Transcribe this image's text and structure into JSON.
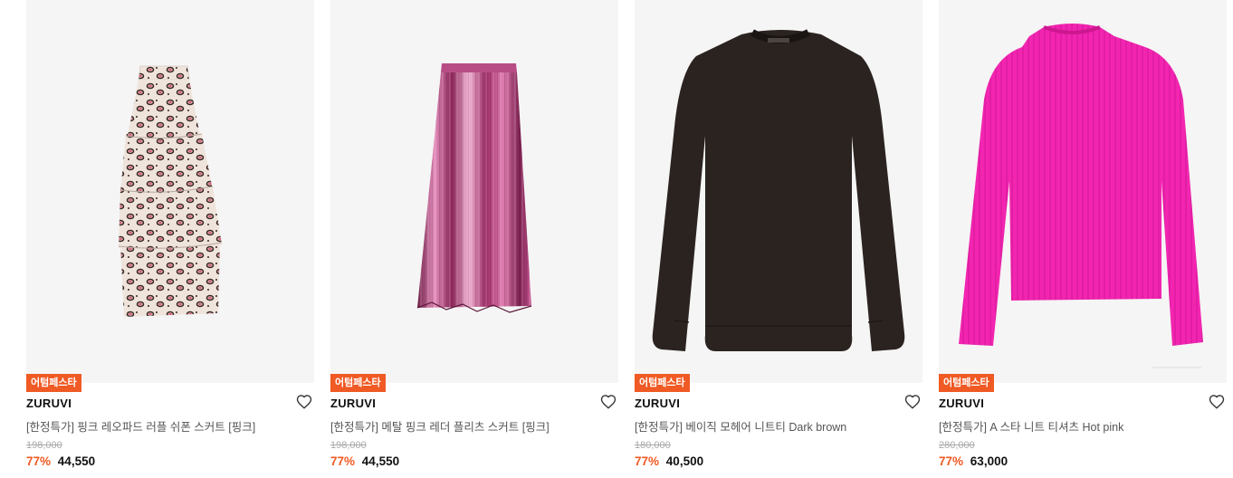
{
  "products": [
    {
      "badge": "어텀페스타",
      "brand": "ZURUVI",
      "name": "[한정특가] 핑크 레오파드 러플 쉬폰 스커트 [핑크]",
      "original_price": "198,000",
      "discount": "77%",
      "sale_price": "44,550",
      "image": "leopard-ruffle-skirt"
    },
    {
      "badge": "어텀페스타",
      "brand": "ZURUVI",
      "name": "[한정특가] 메탈 핑크 레더 플리츠 스커트 [핑크]",
      "original_price": "198,000",
      "discount": "77%",
      "sale_price": "44,550",
      "image": "metallic-pleated-skirt"
    },
    {
      "badge": "어텀페스타",
      "brand": "ZURUVI",
      "name": "[한정특가] 베이직 모헤어 니트티 Dark brown",
      "original_price": "180,000",
      "discount": "77%",
      "sale_price": "40,500",
      "image": "dark-brown-knit"
    },
    {
      "badge": "어텀페스타",
      "brand": "ZURUVI",
      "name": "[한정특가] A 스타 니트 티셔츠 Hot pink",
      "original_price": "280,000",
      "discount": "77%",
      "sale_price": "63,000",
      "image": "hot-pink-knit"
    }
  ],
  "colors": {
    "accent": "#f05a24",
    "thumb_bg": "#f5f5f5"
  },
  "icons": {
    "wishlist": "heart-outline-icon"
  }
}
